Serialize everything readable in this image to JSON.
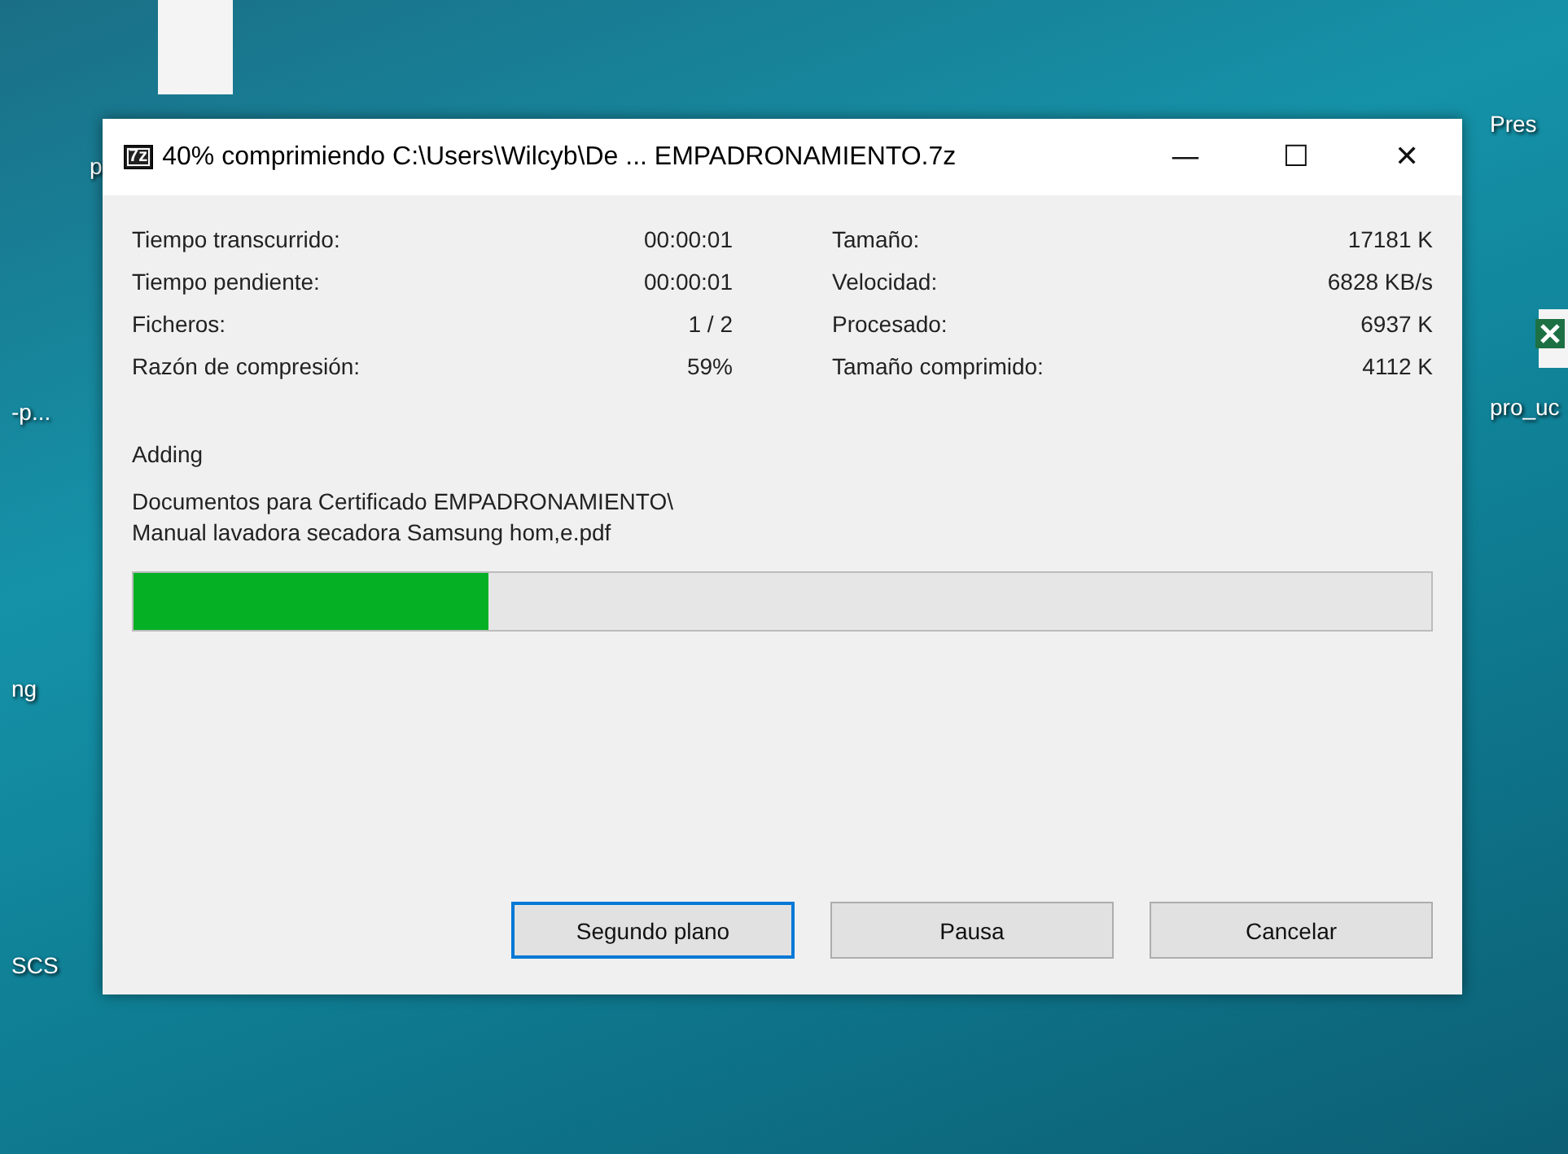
{
  "desktop": {
    "left_icons": [
      "p",
      "-p...",
      "ng",
      "SCS"
    ],
    "right_icons": [
      "Pres",
      "pro_uc"
    ]
  },
  "window": {
    "title": "40% comprimiendo C:\\Users\\Wilcyb\\De ... EMPADRONAMIENTO.7z",
    "app_badge": "7z",
    "controls": [
      "—",
      "☐",
      "✕"
    ]
  },
  "stats_left": [
    {
      "label": "Tiempo transcurrido:",
      "value": "00:00:01"
    },
    {
      "label": "Tiempo pendiente:",
      "value": "00:00:01"
    },
    {
      "label": "Ficheros:",
      "value": "1 / 2"
    },
    {
      "label": "Razón de compresión:",
      "value": "59%"
    }
  ],
  "stats_right": [
    {
      "label": "Tamaño:",
      "value": "17181 K"
    },
    {
      "label": "Velocidad:",
      "value": "6828 KB/s"
    },
    {
      "label": "Procesado:",
      "value": "6937 K"
    },
    {
      "label": "Tamaño comprimido:",
      "value": "4112 K"
    }
  ],
  "operation": "Adding",
  "current_file": [
    "Documentos para Certificado EMPADRONAMIENTO\\",
    "Manual lavadora secadora Samsung hom,e.pdf"
  ],
  "progress": {
    "level": 0.274
  },
  "buttons": [
    {
      "label": "Segundo plano",
      "focused": true
    },
    {
      "label": "Pausa",
      "focused": false
    },
    {
      "label": "Cancelar",
      "focused": false
    }
  ]
}
